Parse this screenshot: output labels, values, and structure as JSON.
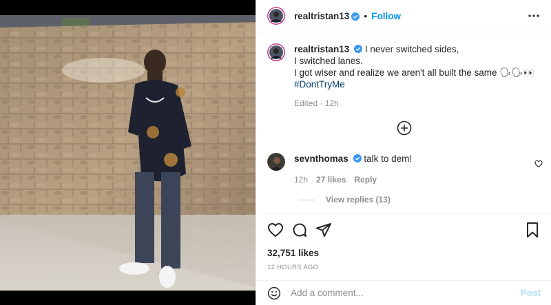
{
  "header": {
    "username": "realtristan13",
    "separator": "•",
    "follow_label": "Follow",
    "more_icon": "more-horizontal-icon"
  },
  "caption": {
    "username": "realtristan13",
    "lines": [
      "I never switched sides,",
      "I switched lanes.",
      "I got wiser and realize we aren't all built the same 🗣🗣👀"
    ],
    "hashtag": "#DontTryMe",
    "meta": "Edited · 12h"
  },
  "load_more_icon": "plus-circle-icon",
  "comment": {
    "username": "sevnthomas",
    "text": "talk to dem!",
    "time": "12h",
    "likes": "27 likes",
    "reply_label": "Reply",
    "view_replies": "View replies (13)"
  },
  "actions": {
    "likes": "32,751 likes",
    "time": "12 HOURS AGO",
    "icons": [
      "heart-icon",
      "comment-icon",
      "share-icon",
      "bookmark-icon"
    ]
  },
  "add_comment": {
    "placeholder": "Add a comment...",
    "post_label": "Post"
  },
  "colors": {
    "accent": "#0095f6",
    "hashtag": "#00376b",
    "muted": "#8e8e8e",
    "post_disabled": "#b2dffc"
  }
}
